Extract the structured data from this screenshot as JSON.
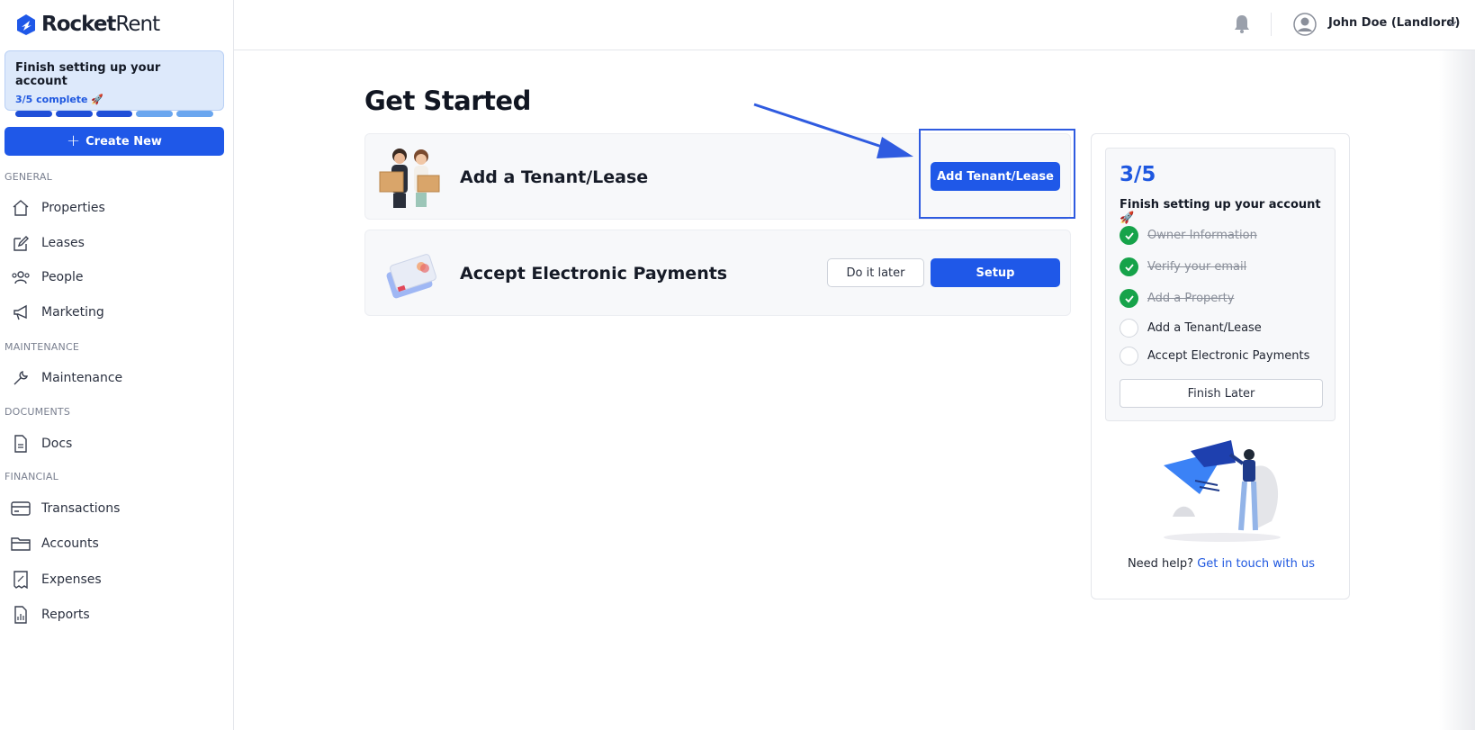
{
  "brand": {
    "name_bold": "Rocket",
    "name_light": "Rent"
  },
  "setup_card": {
    "title": "Finish setting up your account",
    "progress_text": "3/5 complete",
    "completed": 3,
    "total": 5,
    "done_color": "#1f4fd8",
    "todo_color": "#6aa6ef"
  },
  "sidebar": {
    "create_label": "Create New",
    "sections": {
      "general": "GENERAL",
      "maintenance": "MAINTENANCE",
      "documents": "DOCUMENTS",
      "financial": "FINANCIAL"
    },
    "items": {
      "properties": "Properties",
      "leases": "Leases",
      "people": "People",
      "marketing": "Marketing",
      "maintenance": "Maintenance",
      "docs": "Docs",
      "transactions": "Transactions",
      "accounts": "Accounts",
      "expenses": "Expenses",
      "reports": "Reports"
    }
  },
  "header": {
    "user_name": "John Doe (Landlord)"
  },
  "main": {
    "title": "Get Started",
    "tasks": [
      {
        "label": "Add a Tenant/Lease",
        "primary_label": "Add Tenant/Lease"
      },
      {
        "label": "Accept Electronic Payments",
        "secondary_label": "Do it later",
        "primary_label": "Setup"
      }
    ]
  },
  "panel": {
    "count": "3/5",
    "title": "Finish setting up your account 🚀",
    "checklist": [
      {
        "label": "Owner Information",
        "done": true
      },
      {
        "label": "Verify your email",
        "done": true
      },
      {
        "label": "Add a Property",
        "done": true
      },
      {
        "label": "Add a Tenant/Lease",
        "done": false
      },
      {
        "label": "Accept Electronic Payments",
        "done": false
      }
    ],
    "finish_label": "Finish Later",
    "help_text": "Need help?",
    "help_link": "Get in touch with us"
  },
  "colors": {
    "accent": "#1f58e8",
    "success": "#16a34a",
    "highlight": "#2f5be0"
  }
}
